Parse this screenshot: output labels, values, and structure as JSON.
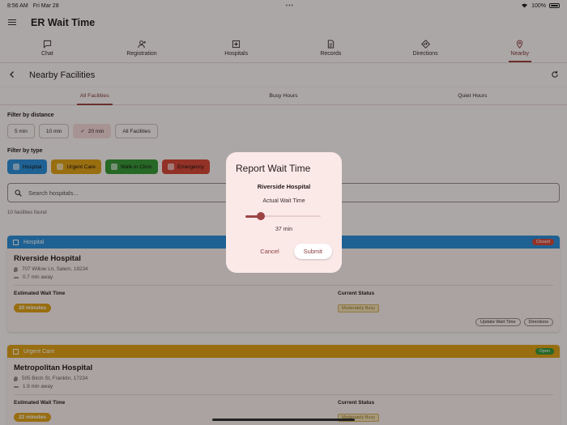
{
  "status_bar": {
    "time": "8:56 AM",
    "date": "Fri Mar 28",
    "battery": "100%"
  },
  "app": {
    "title": "ER Wait Time"
  },
  "nav_tabs": [
    {
      "label": "Chat",
      "icon": "chat-icon"
    },
    {
      "label": "Registration",
      "icon": "person-add-icon"
    },
    {
      "label": "Hospitals",
      "icon": "hospital-plus-icon"
    },
    {
      "label": "Records",
      "icon": "document-icon"
    },
    {
      "label": "Directions",
      "icon": "directions-icon"
    },
    {
      "label": "Nearby",
      "icon": "location-pin-icon"
    }
  ],
  "active_nav": "Nearby",
  "page": {
    "title": "Nearby Facilities"
  },
  "sub_tabs": [
    "All Facilities",
    "Busy Hours",
    "Quiet Hours"
  ],
  "filters": {
    "distance_label": "Filter by distance",
    "distance_options": [
      "5 min",
      "10 min",
      "20 min",
      "All Facilities"
    ],
    "distance_selected": "20 min",
    "type_label": "Filter by type",
    "types": [
      {
        "label": "Hospital",
        "color": "#2f8fd8"
      },
      {
        "label": "Urgent Care",
        "color": "#e0a21a"
      },
      {
        "label": "Walk-in Clinic",
        "color": "#3a9a3a"
      },
      {
        "label": "Emergency",
        "color": "#d84a3a"
      }
    ]
  },
  "search": {
    "placeholder": "Search hospitals..."
  },
  "results_count": "10 facilities found",
  "cards": [
    {
      "type": "Hospital",
      "head_color": "#2f8fd8",
      "badge": "Closed",
      "badge_color": "#d84a3a",
      "name": "Riverside Hospital",
      "address": "707 Willow Ln, Salem, 19234",
      "distance": "0.7 min away",
      "wait_label": "Estimated Wait Time",
      "wait": "20 minutes",
      "status_label": "Current Status",
      "status": "Moderately Busy",
      "actions": [
        "Update Wait Time",
        "Directions"
      ]
    },
    {
      "type": "Urgent Care",
      "head_color": "#e0a21a",
      "badge": "Open",
      "badge_color": "#3a9a3a",
      "name": "Metropolitan Hospital",
      "address": "505 Birch St, Franklin, 17234",
      "distance": "1.9 min away",
      "wait_label": "Estimated Wait Time",
      "wait": "22 minutes",
      "status_label": "Current Status",
      "status": "Moderately Busy"
    }
  ],
  "dialog": {
    "title": "Report Wait Time",
    "facility": "Riverside Hospital",
    "slider_label": "Actual Wait Time",
    "slider_fraction": 0.2,
    "value": "37 min",
    "cancel": "Cancel",
    "submit": "Submit"
  }
}
